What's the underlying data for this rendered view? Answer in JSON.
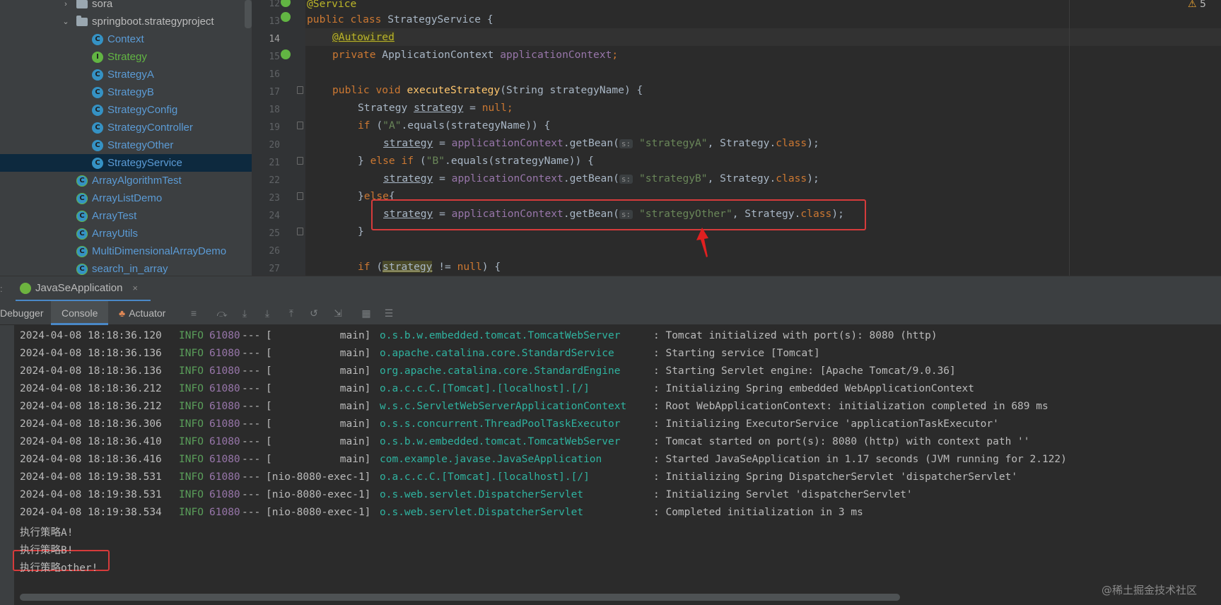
{
  "project_tree": {
    "items": [
      {
        "label": "sora",
        "kind": "folder",
        "expanded": false
      },
      {
        "label": "springboot.strategyproject",
        "kind": "folder",
        "expanded": true
      },
      {
        "label": "Context",
        "kind": "class",
        "badge": "C"
      },
      {
        "label": "Strategy",
        "kind": "interface",
        "badge": "I"
      },
      {
        "label": "StrategyA",
        "kind": "class",
        "badge": "C"
      },
      {
        "label": "StrategyB",
        "kind": "class",
        "badge": "C"
      },
      {
        "label": "StrategyConfig",
        "kind": "class",
        "badge": "C"
      },
      {
        "label": "StrategyController",
        "kind": "class",
        "badge": "C"
      },
      {
        "label": "StrategyOther",
        "kind": "class",
        "badge": "C"
      },
      {
        "label": "StrategyService",
        "kind": "class",
        "badge": "C",
        "selected": true
      },
      {
        "label": "ArrayAlgorithmTest",
        "kind": "class",
        "badge": "C"
      },
      {
        "label": "ArrayListDemo",
        "kind": "class",
        "badge": "C"
      },
      {
        "label": "ArrayTest",
        "kind": "class",
        "badge": "C"
      },
      {
        "label": "ArrayUtils",
        "kind": "class",
        "badge": "C"
      },
      {
        "label": "MultiDimensionalArrayDemo",
        "kind": "class",
        "badge": "C"
      },
      {
        "label": "search_in_array",
        "kind": "class",
        "badge": "C"
      }
    ]
  },
  "editor": {
    "line_numbers": [
      "12",
      "13",
      "14",
      "15",
      "16",
      "17",
      "18",
      "19",
      "20",
      "21",
      "22",
      "23",
      "24",
      "25",
      "26",
      "27"
    ],
    "current_line": "14",
    "param_hint": "s:",
    "warnings": {
      "icon": "warning-icon",
      "count": "5"
    },
    "code": {
      "l12": "@Service",
      "l13_kw": "public class ",
      "l13_name": "StrategyService {",
      "l14_ann": "@Autowired",
      "l15_kw": "private ",
      "l15_type": "ApplicationContext ",
      "l15_field": "applicationContext",
      "l15_end": ";",
      "l17_kw": "public void ",
      "l17_fn": "executeStrategy",
      "l17_rest": "(String strategyName) {",
      "l18_type": "Strategy ",
      "l18_var": "strategy",
      "l18_eq": " = ",
      "l18_null": "null",
      "l18_end": ";",
      "l19_kw": "if ",
      "l19_p1": "(",
      "l19_str": "\"A\"",
      "l19_rest": ".equals(strategyName)) {",
      "l20_var": "strategy",
      "l20_eq": " = ",
      "l20_field": "applicationContext",
      "l20_call": ".getBean(",
      "l20_str": "\"strategyA\"",
      "l20_cls": ", Strategy.",
      "l20_kw": "class",
      "l20_end": ");",
      "l21_open": "} ",
      "l21_kw": "else if ",
      "l21_p1": "(",
      "l21_str": "\"B\"",
      "l21_rest": ".equals(strategyName)) {",
      "l22_var": "strategy",
      "l22_eq": " = ",
      "l22_field": "applicationContext",
      "l22_call": ".getBean(",
      "l22_str": "\"strategyB\"",
      "l22_cls": ", Strategy.",
      "l22_kw": "class",
      "l22_end": ");",
      "l23_open": "}",
      "l23_kw": "else",
      "l23_end": "{",
      "l24_var": "strategy",
      "l24_eq": " = ",
      "l24_field": "applicationContext",
      "l24_call": ".getBean(",
      "l24_str": "\"strategyOther\"",
      "l24_cls": ", Strategy.",
      "l24_kw": "class",
      "l24_end": ");",
      "l25": "}",
      "l27_kw": "if ",
      "l27_p1": "(",
      "l27_var": "strategy",
      "l27_op": " != ",
      "l27_null": "null",
      "l27_end": ") {"
    }
  },
  "run_window": {
    "tab_title": "JavaSeApplication",
    "tab_close": "×",
    "tabs": [
      "Debugger",
      "Console",
      "Actuator"
    ],
    "active_tab": "Console",
    "log_lines": [
      {
        "ts": "2024-04-08 18:18:36.120",
        "level": "INFO",
        "pid": "61080",
        "sep": "---",
        "thread": "[           main]",
        "logger": "o.s.b.w.embedded.tomcat.TomcatWebServer",
        "msg": ": Tomcat initialized with port(s): 8080 (http)"
      },
      {
        "ts": "2024-04-08 18:18:36.136",
        "level": "INFO",
        "pid": "61080",
        "sep": "---",
        "thread": "[           main]",
        "logger": "o.apache.catalina.core.StandardService",
        "msg": ": Starting service [Tomcat]"
      },
      {
        "ts": "2024-04-08 18:18:36.136",
        "level": "INFO",
        "pid": "61080",
        "sep": "---",
        "thread": "[           main]",
        "logger": "org.apache.catalina.core.StandardEngine",
        "msg": ": Starting Servlet engine: [Apache Tomcat/9.0.36]"
      },
      {
        "ts": "2024-04-08 18:18:36.212",
        "level": "INFO",
        "pid": "61080",
        "sep": "---",
        "thread": "[           main]",
        "logger": "o.a.c.c.C.[Tomcat].[localhost].[/]",
        "msg": ": Initializing Spring embedded WebApplicationContext"
      },
      {
        "ts": "2024-04-08 18:18:36.212",
        "level": "INFO",
        "pid": "61080",
        "sep": "---",
        "thread": "[           main]",
        "logger": "w.s.c.ServletWebServerApplicationContext",
        "msg": ": Root WebApplicationContext: initialization completed in 689 ms"
      },
      {
        "ts": "2024-04-08 18:18:36.306",
        "level": "INFO",
        "pid": "61080",
        "sep": "---",
        "thread": "[           main]",
        "logger": "o.s.s.concurrent.ThreadPoolTaskExecutor",
        "msg": ": Initializing ExecutorService 'applicationTaskExecutor'"
      },
      {
        "ts": "2024-04-08 18:18:36.410",
        "level": "INFO",
        "pid": "61080",
        "sep": "---",
        "thread": "[           main]",
        "logger": "o.s.b.w.embedded.tomcat.TomcatWebServer",
        "msg": ": Tomcat started on port(s): 8080 (http) with context path ''"
      },
      {
        "ts": "2024-04-08 18:18:36.416",
        "level": "INFO",
        "pid": "61080",
        "sep": "---",
        "thread": "[           main]",
        "logger": "com.example.javase.JavaSeApplication",
        "msg": ": Started JavaSeApplication in 1.17 seconds (JVM running for 2.122)"
      },
      {
        "ts": "2024-04-08 18:19:38.531",
        "level": "INFO",
        "pid": "61080",
        "sep": "---",
        "thread": "[nio-8080-exec-1]",
        "logger": "o.a.c.c.C.[Tomcat].[localhost].[/]",
        "msg": ": Initializing Spring DispatcherServlet 'dispatcherServlet'"
      },
      {
        "ts": "2024-04-08 18:19:38.531",
        "level": "INFO",
        "pid": "61080",
        "sep": "---",
        "thread": "[nio-8080-exec-1]",
        "logger": "o.s.web.servlet.DispatcherServlet",
        "msg": ": Initializing Servlet 'dispatcherServlet'"
      },
      {
        "ts": "2024-04-08 18:19:38.534",
        "level": "INFO",
        "pid": "61080",
        "sep": "---",
        "thread": "[nio-8080-exec-1]",
        "logger": "o.s.web.servlet.DispatcherServlet",
        "msg": ": Completed initialization in 3 ms"
      }
    ],
    "output_lines": [
      "执行策略A!",
      "执行策略B!",
      "执行策略other!"
    ]
  },
  "watermark": "@稀土掘金技术社区",
  "colors": {
    "highlight_box": "#d63b3b",
    "keyword": "#cc7832",
    "string": "#6a8759",
    "field": "#9876aa",
    "logger": "#2fb3a0"
  }
}
